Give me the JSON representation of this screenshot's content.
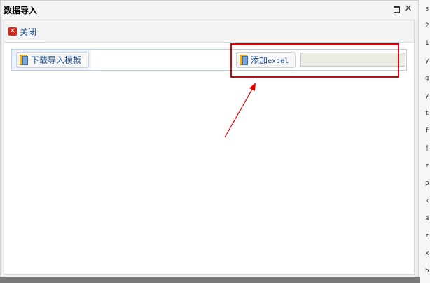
{
  "window": {
    "title": "数据导入",
    "maximize_icon": "maximize-icon",
    "close_icon": "close-icon"
  },
  "toolbar": {
    "close_label": "关闭",
    "close_icon": "close-x-icon"
  },
  "panel": {
    "download_template_label": "下载导入模板",
    "add_label_prefix": "添加",
    "add_label_suffix": "excel",
    "file_field_value": ""
  },
  "background_column": {
    "lines": [
      "s",
      "2",
      "1",
      "y",
      "g",
      "y",
      "t",
      "f",
      "j",
      "z",
      "p",
      "k",
      "a",
      "z",
      "x",
      "b"
    ]
  },
  "colors": {
    "accent_link": "#1f4e8c",
    "annotation_red": "#e00000",
    "close_red": "#d9261c"
  }
}
